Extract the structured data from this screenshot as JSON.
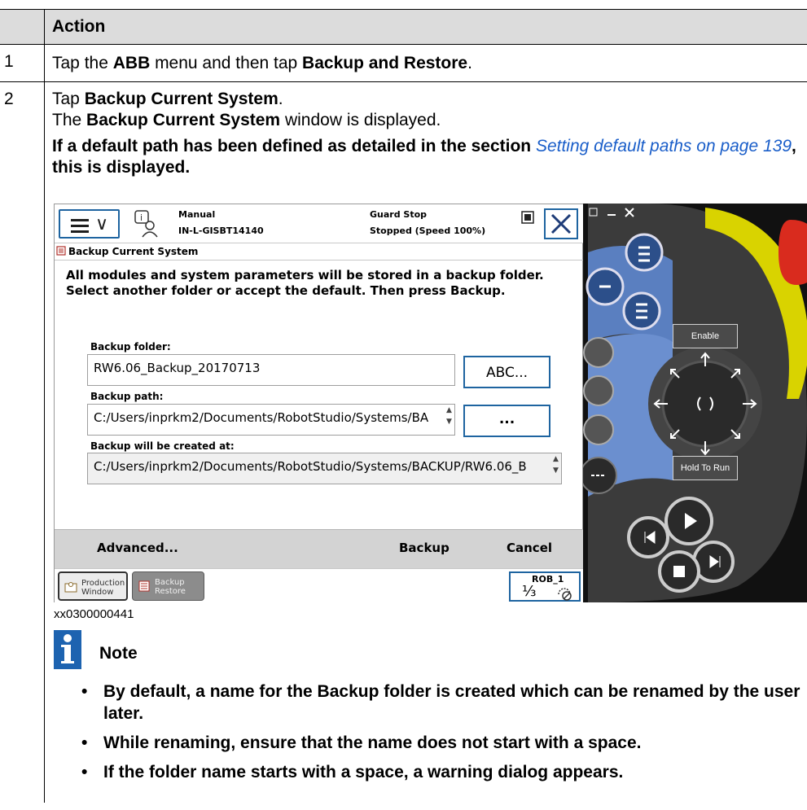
{
  "header": {
    "action": "Action"
  },
  "rows": [
    {
      "num": "1",
      "parts": [
        "Tap the ",
        "ABB",
        " menu and then tap ",
        "Backup and Restore",
        "."
      ]
    },
    {
      "num": "2",
      "line1": [
        "Tap ",
        "Backup Current System",
        "."
      ],
      "line2": [
        "The ",
        "Backup Current System",
        " window is displayed."
      ],
      "line3_pre": "If a default path has been defined as detailed in the section ",
      "line3_link": "Setting default paths on page 139",
      "line3_post": ", this is displayed."
    }
  ],
  "flexpendant": {
    "status": {
      "mode": "Manual",
      "system": "IN-L-GISBT14140",
      "state": "Guard Stop",
      "speed": "Stopped (Speed 100%)"
    },
    "window_title": "Backup Current System",
    "intro_text": "All modules and system parameters will be stored in a backup folder. Select another folder or accept the default. Then press Backup.",
    "backup_folder": {
      "label": "Backup folder:",
      "value": "RW6.06_Backup_20170713",
      "button": "ABC..."
    },
    "backup_path": {
      "label": "Backup path:",
      "value": "C:/Users/inprkm2/Documents/RobotStudio/Systems/BA",
      "button": "..."
    },
    "created_at": {
      "label": "Backup will be created at:",
      "value": "C:/Users/inprkm2/Documents/RobotStudio/Systems/BACKUP/RW6.06_B"
    },
    "commands": {
      "advanced": "Advanced...",
      "backup": "Backup",
      "cancel": "Cancel"
    },
    "taskbar": {
      "production": [
        "Production",
        "Window"
      ],
      "backup_restore": [
        "Backup",
        "Restore"
      ],
      "rob": "ROB_1",
      "fraction": "⅓"
    },
    "device": {
      "enable": "Enable",
      "hold_to_run": "Hold To Run"
    }
  },
  "caption": "xx0300000441",
  "note": {
    "title": "Note",
    "items": [
      "By default, a name for the Backup folder is created which can be renamed by the user later.",
      "While renaming, ensure that the name does not start with a space.",
      "If the folder name starts with a space, a warning dialog appears."
    ]
  },
  "colors": {
    "link": "#1a5ec9",
    "note_icon": "#1d63b0",
    "ui_accent": "#1e64a0",
    "header_bg": "#dcdcdc"
  }
}
